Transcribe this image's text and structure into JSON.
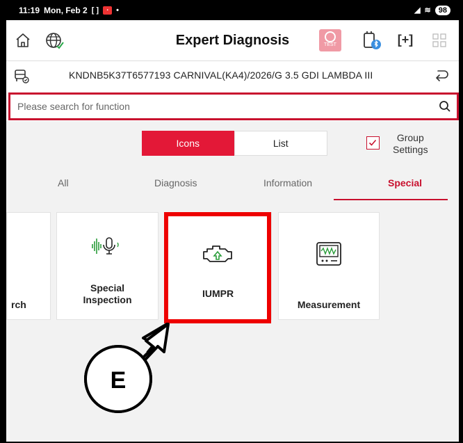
{
  "status_bar": {
    "time": "11:19",
    "date": "Mon, Feb 2",
    "battery": "98"
  },
  "header": {
    "title": "Expert Diagnosis",
    "test_badge": "TEST"
  },
  "vehicle": {
    "info": "KNDNB5K37T6577193 CARNIVAL(KA4)/2026/G 3.5 GDI LAMBDA III"
  },
  "search": {
    "placeholder": "Please search for function"
  },
  "view_toggle": {
    "icons_label": "Icons",
    "list_label": "List",
    "active": "Icons"
  },
  "group_settings": {
    "line1": "Group",
    "line2": "Settings",
    "checked": true
  },
  "tabs": [
    {
      "label": "All",
      "active": false
    },
    {
      "label": "Diagnosis",
      "active": false
    },
    {
      "label": "Information",
      "active": false
    },
    {
      "label": "Special",
      "active": true
    }
  ],
  "function_cards": [
    {
      "label": "rch",
      "icon": "partial-card"
    },
    {
      "label_line1": "Special",
      "label_line2": "Inspection",
      "icon": "voice-wave-icon"
    },
    {
      "label": "IUMPR",
      "icon": "engine-icon"
    },
    {
      "label": "Measurement",
      "icon": "oscilloscope-icon"
    }
  ],
  "callout": {
    "letter": "E"
  },
  "colors": {
    "accent": "#e31837",
    "highlight": "#ee0000",
    "background": "#f2f2f2"
  }
}
